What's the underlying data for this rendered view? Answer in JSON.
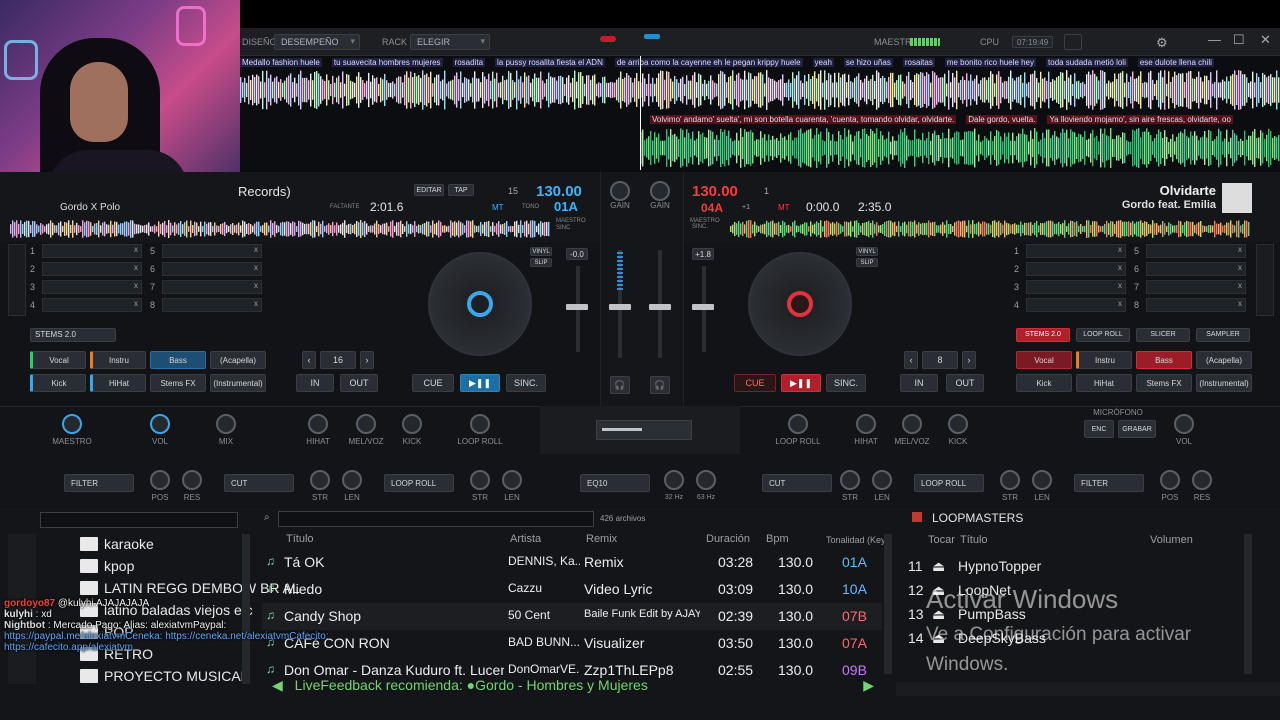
{
  "menubar": {
    "diseno_label": "DISEÑO",
    "diseno_value": "DESEMPEÑO",
    "rack_label": "RACK",
    "rack_value": "ELEGIR",
    "maestro_label": "MAESTRO",
    "cpu_label": "CPU",
    "time": "07:19:49"
  },
  "lyrics_top": [
    "Medallo fashion huele",
    "tu suavecita hombres mujeres",
    "rosadita",
    "la pussy rosalita fiesta el ADN",
    "de arriba como la cayenne eh le pegan krippy huele",
    "yeah",
    "se hizo uñas",
    "rosaitas",
    "me bonito rico huele hey",
    "toda sudada metió loli",
    "ese dulote llena chili"
  ],
  "lyrics_bottom": [
    "Volvimo' andamo' suelta', mi son botella cuarenta, 'cuenta, tomando olvidar, olvidarte.",
    "Dale gordo, vuelta.",
    "Ya lloviendo mojamo', sin aire frescas, olvidarte, oo"
  ],
  "deck_left": {
    "title_partial": "Records)",
    "artist_partial": "Gordo X Polo",
    "faltante_label": "FALTANTE",
    "time": "2:01.6",
    "editar": "EDITAR",
    "tap": "TAP",
    "bpm": "130.00",
    "key": "01A",
    "mt": "MT",
    "tono": "TONO",
    "beats": "15",
    "maestro_sinc": "MAESTRO SINC",
    "pitch": "-0.0",
    "stems_label": "STEMS 2.0",
    "stems": [
      "Vocal",
      "Instru",
      "Bass",
      "(Acapella)",
      "Kick",
      "HiHat",
      "Stems FX",
      "(Instrumental)"
    ],
    "loop_size": "16",
    "in": "IN",
    "out": "OUT",
    "cue": "CUE",
    "play": "▶❚❚",
    "sinc": "SINC.",
    "vinyl": "VINYL",
    "slip": "SLIP",
    "pads": [
      "1",
      "2",
      "3",
      "4",
      "5",
      "6",
      "7",
      "8"
    ],
    "knobs": [
      "MAESTRO",
      "VOL",
      "MIX",
      "HIHAT",
      "MEL/VOZ",
      "KICK",
      "LOOP ROLL"
    ],
    "fx_row": [
      "FILTER",
      "POS",
      "RES",
      "CUT",
      "STR",
      "LEN",
      "LOOP ROLL",
      "STR",
      "LEN"
    ]
  },
  "mixer": {
    "gain_left": "GAIN",
    "gain_right": "GAIN",
    "eq_label": "EQ10",
    "hz1": "32 Hz",
    "hz2": "63 Hz"
  },
  "deck_right": {
    "bpm": "130.00",
    "key": "04A",
    "mt": "MT",
    "sinc_label": "SINC.",
    "maestro_label": "MAESTRO",
    "beats": "1",
    "offset": "+1",
    "elapsed": "0:00.0",
    "duration": "2:35.0",
    "title": "Olvidarte",
    "artist": "Gordo feat. Emilia",
    "pitch": "+1.8",
    "stems_tab": "STEMS 2.0",
    "loop_roll_tab": "LOOP ROLL",
    "slicer_tab": "SLICER",
    "sampler_tab": "SAMPLER",
    "stems": [
      "Vocal",
      "Instru",
      "Bass",
      "(Acapella)",
      "Kick",
      "HiHat",
      "Stems FX",
      "(Instrumental)"
    ],
    "loop_size": "8",
    "in": "IN",
    "out": "OUT",
    "cue": "CUE",
    "play": "▶❚❚",
    "sinc": "SINC.",
    "vinyl": "VINYL",
    "slip": "SLIP",
    "pads": [
      "1",
      "2",
      "3",
      "4",
      "5",
      "6",
      "7",
      "8"
    ],
    "knobs": [
      "LOOP ROLL",
      "HIHAT",
      "MEL/VOZ",
      "KICK",
      "VOL"
    ],
    "microfono": "MICRÓFONO",
    "enc": "ENC",
    "grabar": "GRABAR",
    "fx_row": [
      "CUT",
      "STR",
      "LEN",
      "LOOP ROLL",
      "STR",
      "LEN",
      "FILTER",
      "POS",
      "RES"
    ]
  },
  "browser": {
    "file_count": "426 archivos",
    "headers": {
      "title": "Título",
      "artist": "Artista",
      "remix": "Remix",
      "duration": "Duración",
      "bpm": "Bpm",
      "key": "Tonalidad (Key)"
    },
    "folders": [
      "karaoke",
      "kpop",
      "LATIN REGG DEMBOW BR AL",
      "latino baladas viejos etc",
      "POP",
      "RETRO",
      "PROYECTO MUSICAL"
    ],
    "rows": [
      {
        "title": "Tá OK",
        "artist": "DENNIS, Ka...",
        "remix": "Remix",
        "duration": "03:28",
        "bpm": "130.0",
        "key": "01A",
        "key_color": "#56c1ff"
      },
      {
        "title": "Miedo",
        "artist": "Cazzu",
        "remix": "Video Lyric",
        "duration": "03:09",
        "bpm": "130.0",
        "key": "10A",
        "key_color": "#6fb8ff"
      },
      {
        "title": "Candy Shop",
        "artist": "50 Cent",
        "remix": "Baile Funk Edit by AJAY",
        "duration": "02:39",
        "bpm": "130.0",
        "key": "07B",
        "key_color": "#ff6b6b"
      },
      {
        "title": "CAFé CON RON",
        "artist": "BAD BUNN...",
        "remix": "Visualizer",
        "duration": "03:50",
        "bpm": "130.0",
        "key": "07A",
        "key_color": "#ff6b6b"
      },
      {
        "title": "Don Omar - Danza Kuduro ft. Lucenzo",
        "artist": "DonOmarVE...",
        "remix": "Zzp1ThLEPp8",
        "duration": "02:55",
        "bpm": "130.0",
        "key": "09B",
        "key_color": "#c67bff"
      }
    ],
    "livefeedback": "LiveFeedback recomienda: ●Gordo - Hombres y Mujeres"
  },
  "loopmasters": {
    "title": "LOOPMASTERS",
    "col_tocar": "Tocar",
    "col_titulo": "Título",
    "col_volumen": "Volumen",
    "items": [
      {
        "num": "11",
        "name": "HypnoTopper"
      },
      {
        "num": "12",
        "name": "LoopNet"
      },
      {
        "num": "13",
        "name": "PumpBass"
      },
      {
        "num": "14",
        "name": "DeepSkyBass"
      }
    ]
  },
  "watermark": {
    "line1": "Activar Windows",
    "line2": "Ve a Configuración para activar",
    "line3": "Windows."
  },
  "chat": [
    {
      "user": "gordoyo87",
      "text": "@kulyhi AJAJAJAJA",
      "color": "#ff3b3b"
    },
    {
      "user": "kulyhi",
      "text": ": xd",
      "color": "#e8e8e8"
    },
    {
      "user": "Nightbot",
      "text": ": Mercado Pago: Alias: alexiatvmPaypal:",
      "color": "#d8d8d8"
    },
    {
      "user": "",
      "text": "https://paypal.me/alexiatvmCeneka: https://ceneka.net/alexiatvmCafecito:",
      "color": "#5aa8ff"
    },
    {
      "user": "",
      "text": "https://cafecito.app/alexiatvm",
      "color": "#5aa8ff"
    }
  ],
  "colors": {
    "accent_blue": "#3aa7e8",
    "accent_red": "#e2323f",
    "green": "#72d472"
  }
}
